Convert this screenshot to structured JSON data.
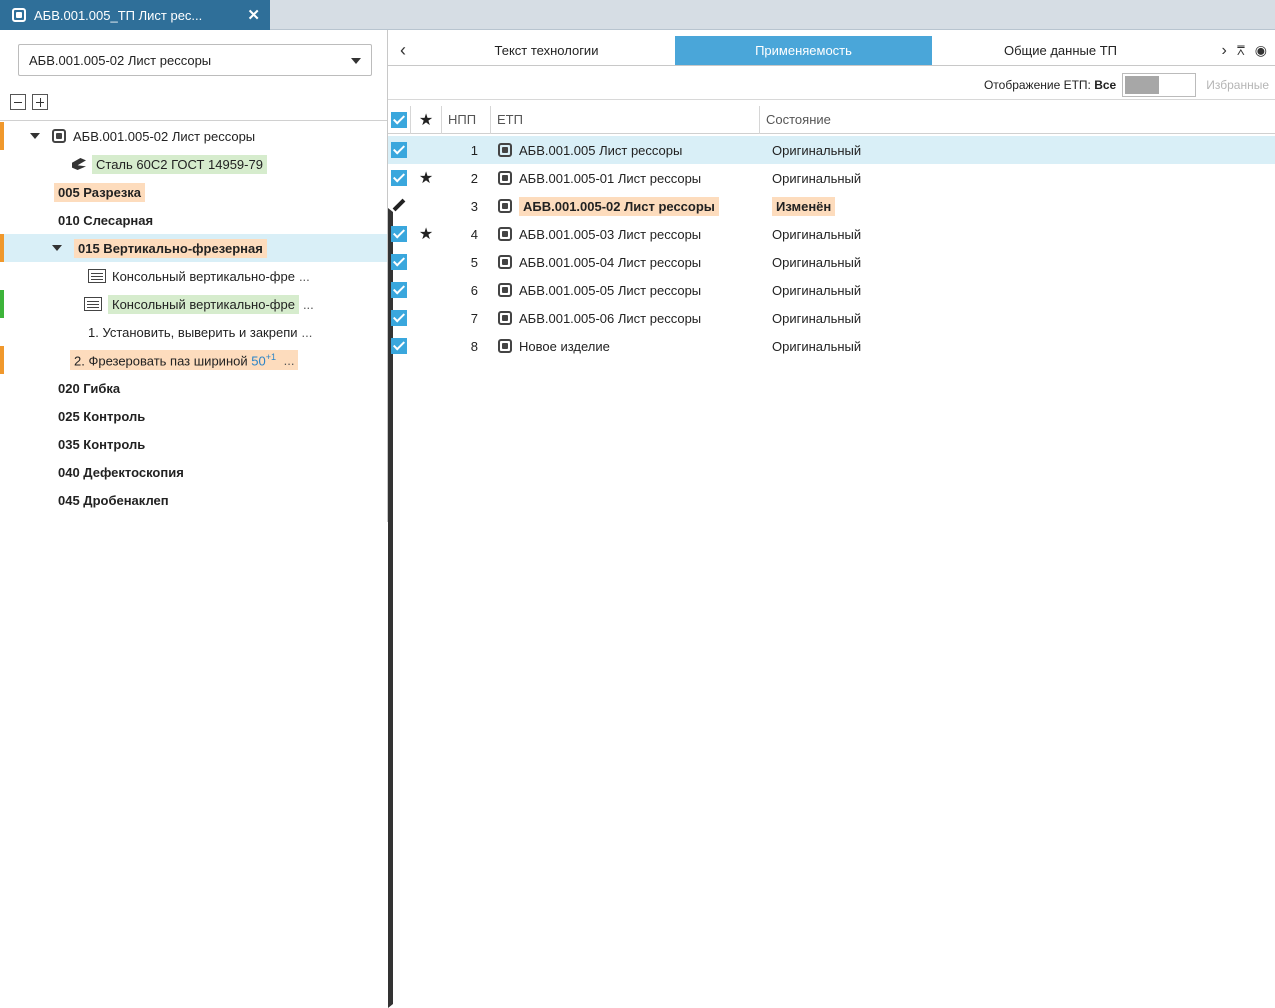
{
  "doc_tab": {
    "title": "АБВ.001.005_ТП Лист рес...",
    "close": "✕"
  },
  "left": {
    "combo_value": "АБВ.001.005-02 Лист рессоры",
    "tree": [
      {
        "label": "АБВ.001.005-02 Лист рессоры"
      },
      {
        "label": "Сталь 60С2 ГОСТ 14959-79"
      },
      {
        "label": "005 Разрезка"
      },
      {
        "label": "010 Слесарная"
      },
      {
        "label": "015 Вертикально-фрезерная"
      },
      {
        "label": "Консольный вертикально-фре"
      },
      {
        "label": "Консольный вертикально-фре"
      },
      {
        "label": "1. Установить, выверить и закрепи"
      },
      {
        "label": "2. Фрезеровать паз шириной",
        "value": "50",
        "tol": "+1"
      },
      {
        "label": "020 Гибка"
      },
      {
        "label": "025 Контроль"
      },
      {
        "label": "035 Контроль"
      },
      {
        "label": "040 Дефектоскопия"
      },
      {
        "label": "045 Дробенаклеп"
      }
    ],
    "more": "..."
  },
  "tabs": {
    "items": [
      "Текст технологии",
      "Применяемость",
      "Общие данные ТП"
    ],
    "active": "Применяемость"
  },
  "toggle": {
    "label": "Отображение ЕТП:",
    "value": "Все",
    "fav": "Избранные"
  },
  "grid": {
    "headers": {
      "star": "★",
      "npp": "НПП",
      "etp": "ЕТП",
      "state": "Состояние"
    },
    "rows": [
      {
        "npp": "1",
        "etp": "АБВ.001.005 Лист рессоры",
        "state": "Оригинальный",
        "star": ""
      },
      {
        "npp": "2",
        "etp": "АБВ.001.005-01 Лист рессоры",
        "state": "Оригинальный",
        "star": "★"
      },
      {
        "npp": "3",
        "etp": "АБВ.001.005-02 Лист рессоры",
        "state": "Изменён",
        "star": ""
      },
      {
        "npp": "4",
        "etp": "АБВ.001.005-03 Лист рессоры",
        "state": "Оригинальный",
        "star": "★"
      },
      {
        "npp": "5",
        "etp": "АБВ.001.005-04 Лист рессоры",
        "state": "Оригинальный",
        "star": ""
      },
      {
        "npp": "6",
        "etp": "АБВ.001.005-05 Лист рессоры",
        "state": "Оригинальный",
        "star": ""
      },
      {
        "npp": "7",
        "etp": "АБВ.001.005-06 Лист рессоры",
        "state": "Оригинальный",
        "star": ""
      },
      {
        "npp": "8",
        "etp": "Новое изделие",
        "state": "Оригинальный",
        "star": ""
      }
    ]
  },
  "colors": {
    "accent": "#4aa6d9",
    "title_tab": "#2f6f99",
    "selected_row": "#d9eff7",
    "changed": "#fddcbd",
    "material": "#d6eccd"
  },
  "icons": [
    "document-icon",
    "close-icon",
    "chevron-down-icon",
    "collapse-all-icon",
    "expand-all-icon",
    "material-icon",
    "machine-icon",
    "chevron-left-icon",
    "chevron-right-icon",
    "filter-icon",
    "eye-icon",
    "star-icon",
    "pencil-icon",
    "checkbox-icon"
  ]
}
